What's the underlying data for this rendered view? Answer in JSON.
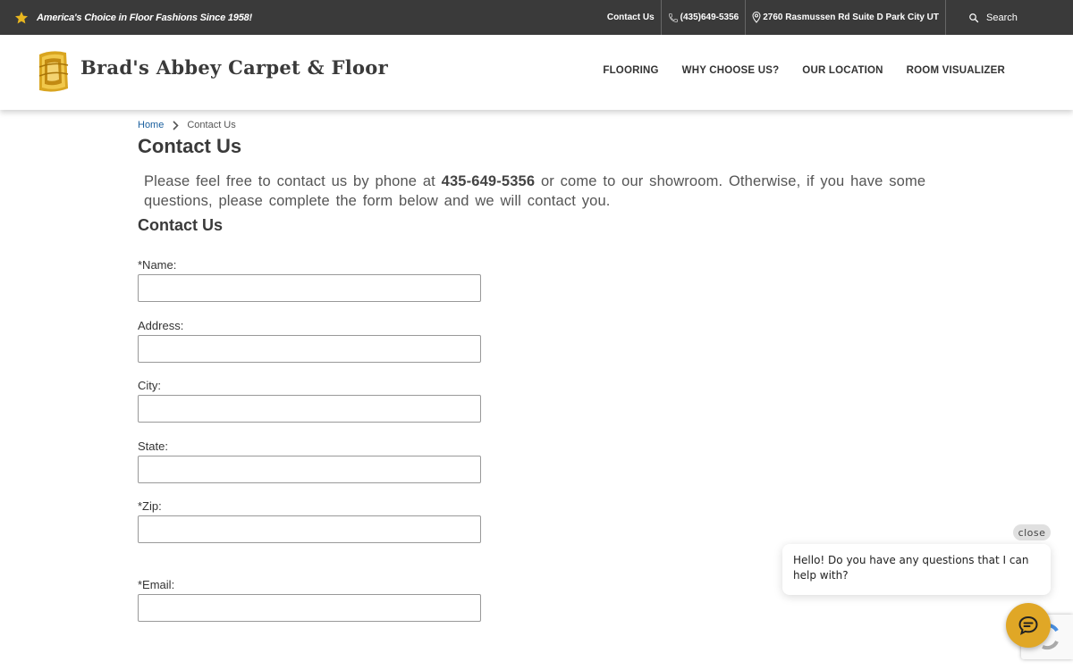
{
  "topbar": {
    "tagline": "America's Choice in Floor Fashions Since 1958!",
    "links": {
      "contact": "Contact Us",
      "phone": "(435)649-5356",
      "address": "2760 Rasmussen Rd Suite D Park City UT",
      "search": "Search"
    }
  },
  "header": {
    "brand": "Brad's Abbey Carpet & Floor",
    "nav": [
      "FLOORING",
      "WHY CHOOSE US?",
      "OUR LOCATION",
      "ROOM VISUALIZER"
    ]
  },
  "breadcrumb": {
    "home": "Home",
    "current": "Contact Us"
  },
  "page_title": "Contact Us",
  "intro": {
    "before": "Please feel free to contact us by phone at ",
    "phone": "435-649-5356",
    "after": " or come to our showroom. Otherwise, if you have some questions, please complete the form below and we will contact you."
  },
  "form": {
    "title": "Contact Us",
    "fields": {
      "name": {
        "label": "*Name:",
        "value": ""
      },
      "address": {
        "label": "Address:",
        "value": ""
      },
      "city": {
        "label": "City:",
        "value": ""
      },
      "state": {
        "label": "State:",
        "value": ""
      },
      "zip": {
        "label": "*Zip:",
        "value": ""
      },
      "email": {
        "label": "*Email:",
        "value": ""
      }
    }
  },
  "chat": {
    "close_label": "close",
    "message": "Hello! Do you have any questions that I can help with?"
  },
  "colors": {
    "topbar_bg": "#3a3a3a",
    "star": "#e8b61f",
    "logo_gold": "#d9a520",
    "link": "#1a5f9e",
    "chat_button": "#e0a726"
  },
  "icons": [
    "star-icon",
    "phone-icon",
    "map-pin-icon",
    "search-icon",
    "logo-icon",
    "chevron-right-icon",
    "chat-icon"
  ]
}
